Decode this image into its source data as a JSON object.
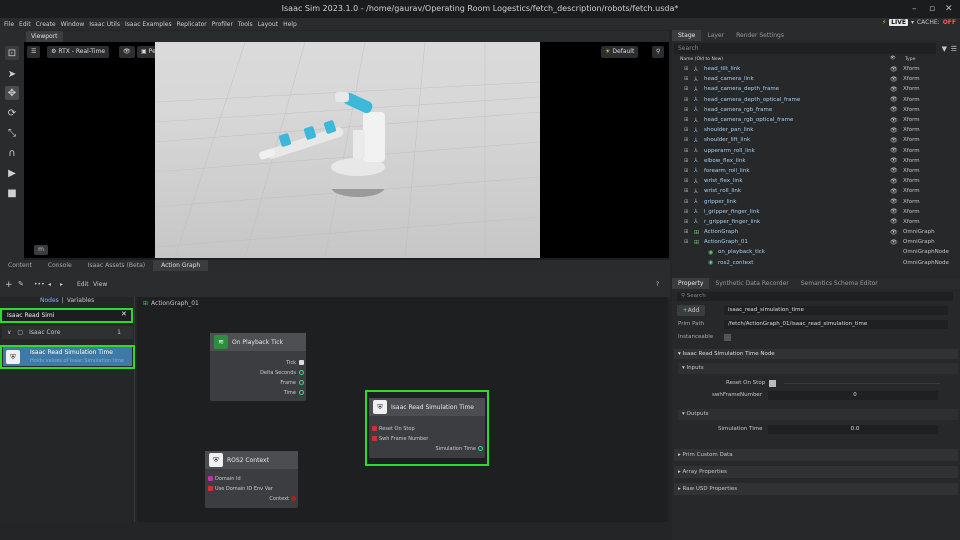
{
  "window": {
    "title": "Isaac Sim 2023.1.0 - /home/gaurav/Operating Room Logestics/fetch_description/robots/fetch.usda*"
  },
  "menu": [
    "File",
    "Edit",
    "Create",
    "Window",
    "Isaac Utils",
    "Isaac Examples",
    "Replicator",
    "Profiler",
    "Tools",
    "Layout",
    "Help"
  ],
  "status": {
    "live": "LIVE",
    "cache": "CACHE:",
    "cache_state": "OFF"
  },
  "viewport": {
    "tab": "Viewport",
    "renderer": "RTX - Real-Time",
    "camera": "Perspective",
    "lighting": "Default",
    "badge": "m"
  },
  "bottom_tabs": [
    "Content",
    "Console",
    "Isaac Assets (Beta)",
    "Action Graph"
  ],
  "action_graph": {
    "edit": "Edit",
    "view": "View",
    "help": "?",
    "nodes_label": "Nodes",
    "sep": "|",
    "variables_label": "Variables",
    "search_value": "Isaac Read Simi",
    "category": "Isaac Core",
    "category_count": "1",
    "result_title": "Isaac Read Simulation Time",
    "result_sub": "Holds values of Isaac Simulation time",
    "graph_path": "ActionGraph_01",
    "nodes": {
      "playback": {
        "title": "On Playback Tick",
        "outputs": [
          "Tick",
          "Delta Seconds",
          "Frame",
          "Time"
        ]
      },
      "simtime": {
        "title": "Isaac Read Simulation Time",
        "inputs": [
          "Reset On Stop",
          "Swh Frame Number"
        ],
        "output": "Simulation Time"
      },
      "ros2": {
        "title": "ROS2 Context",
        "inputs": [
          "Domain Id",
          "Use Domain ID Env Var"
        ],
        "output": "Context"
      }
    }
  },
  "stage": {
    "tabs": [
      "Stage",
      "Layer",
      "Render Settings"
    ],
    "search_placeholder": "Search",
    "col_name": "Name (Old to New)",
    "col_type": "Type",
    "rows": [
      {
        "name": "head_tilt_link",
        "type": "Xform",
        "icon": "xform"
      },
      {
        "name": "head_camera_link",
        "type": "Xform",
        "icon": "xform"
      },
      {
        "name": "head_camera_depth_frame",
        "type": "Xform",
        "icon": "xform"
      },
      {
        "name": "head_camera_depth_optical_frame",
        "type": "Xform",
        "icon": "xform"
      },
      {
        "name": "head_camera_rgb_frame",
        "type": "Xform",
        "icon": "xform"
      },
      {
        "name": "head_camera_rgb_optical_frame",
        "type": "Xform",
        "icon": "xform"
      },
      {
        "name": "shoulder_pan_link",
        "type": "Xform",
        "icon": "xform"
      },
      {
        "name": "shoulder_lift_link",
        "type": "Xform",
        "icon": "xform"
      },
      {
        "name": "upperarm_roll_link",
        "type": "Xform",
        "icon": "xform"
      },
      {
        "name": "elbow_flex_link",
        "type": "Xform",
        "icon": "xform"
      },
      {
        "name": "forearm_roll_link",
        "type": "Xform",
        "icon": "xform"
      },
      {
        "name": "wrist_flex_link",
        "type": "Xform",
        "icon": "xform"
      },
      {
        "name": "wrist_roll_link",
        "type": "Xform",
        "icon": "xform"
      },
      {
        "name": "gripper_link",
        "type": "Xform",
        "icon": "xform"
      },
      {
        "name": "l_gripper_finger_link",
        "type": "Xform",
        "icon": "xform"
      },
      {
        "name": "r_gripper_finger_link",
        "type": "Xform",
        "icon": "xform"
      },
      {
        "name": "ActionGraph",
        "type": "OmniGraph",
        "icon": "graph"
      },
      {
        "name": "ActionGraph_01",
        "type": "OmniGraph",
        "icon": "graph"
      },
      {
        "name": "on_playback_tick",
        "type": "OmniGraphNode",
        "icon": "node"
      },
      {
        "name": "ros2_context",
        "type": "OmniGraphNode",
        "icon": "node"
      }
    ]
  },
  "property": {
    "tabs": [
      "Property",
      "Synthetic Data Recorder",
      "Semantics Schema Editor"
    ],
    "search_placeholder": "Search",
    "add_label": "Add",
    "name_value": "isaac_read_simulation_time",
    "prim_path_label": "Prim Path",
    "prim_path_value": "/fetch/ActionGraph_01/isaac_read_simulation_time",
    "instanceable_label": "Instanceable",
    "node_section": "Isaac Read Simulation Time Node",
    "inputs_label": "Inputs",
    "reset_label": "Reset On Stop",
    "swh_label": "swhFrameNumber",
    "swh_value": "0",
    "outputs_label": "Outputs",
    "simtime_label": "Simulation Time",
    "simtime_value": "0.0",
    "collapsed": [
      "Prim Custom Data",
      "Array Properties",
      "Raw USD Properties"
    ]
  }
}
